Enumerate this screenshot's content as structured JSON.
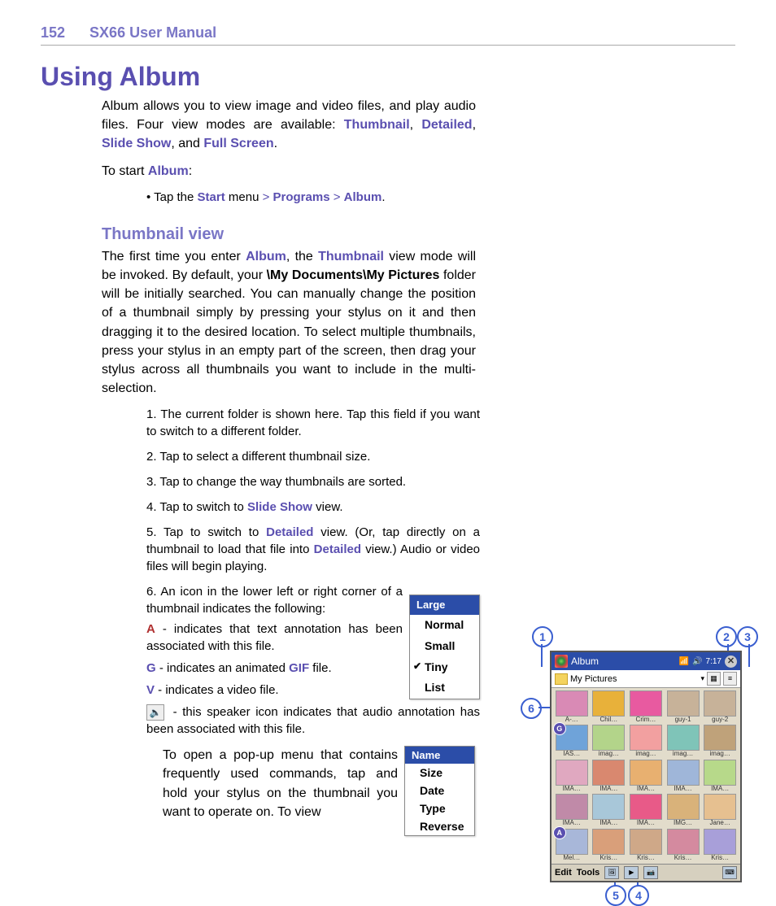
{
  "header": {
    "page_number": "152",
    "manual_title": "SX66 User Manual"
  },
  "main_heading": "Using Album",
  "intro": {
    "pre": "Album allows you to view image and video files, and play audio files. Four view modes are available: ",
    "m1": "Thumbnail",
    "c1": ", ",
    "m2": "Detailed",
    "c2": ", ",
    "m3": "Slide Show",
    "c3": ", and ",
    "m4": "Full Screen",
    "post": "."
  },
  "to_start": {
    "pre": "To start ",
    "link": "Album",
    "post": ":"
  },
  "bullet": {
    "pre": "• Tap the ",
    "l1": "Start",
    "mid1": " menu ",
    "s1": "> ",
    "l2": "Programs",
    "s2": " > ",
    "l3": "Album",
    "post": "."
  },
  "sub_heading": "Thumbnail view",
  "para2": {
    "t1": "The first time you enter ",
    "l1": "Album",
    "t2": ", the ",
    "l2": "Thumbnail",
    "t3": " view mode will be invoked. By default, your ",
    "b1": "\\My Documents\\My Pictures",
    "t4": " folder will be initially searched. You can manually change the position of a thumbnail simply by pressing your stylus on it and then dragging it to the desired location. To select multiple thumbnails, press your stylus in an empty part of the screen, then drag your stylus across all thumbnails you want to include in the multi-selection."
  },
  "list": {
    "i1": "1. The current folder is shown here. Tap this field if you want to switch to a different folder.",
    "i2": "2. Tap to select a different thumbnail size.",
    "i3": "3. Tap to change the way thumbnails are sorted.",
    "i4": {
      "pre": "4. Tap to switch to ",
      "link": "Slide Show",
      "post": " view."
    },
    "i5": {
      "pre": "5. Tap to switch to ",
      "l1": "Detailed",
      "mid": " view. (Or, tap directly on a thumbnail to load that file into ",
      "l2": "Detailed",
      "post": " view.) Audio or video files will begin playing."
    },
    "i6": "6. An icon in the lower left or right corner of a thumbnail indicates the following:",
    "i6a": " - indicates that text annotation has been associated with this file.",
    "i6g_pre": " - indicates an animated ",
    "i6g_link": "GIF",
    "i6g_post": " file.",
    "i6v": " - indicates a video file.",
    "i6s": " - this speaker icon indicates that audio annotation has been associated with this file."
  },
  "letters": {
    "a": "A",
    "g": "G",
    "v": "V"
  },
  "size_menu": {
    "header": "Large",
    "items": [
      "Normal",
      "Small",
      "Tiny",
      "List"
    ],
    "checked": "Tiny"
  },
  "sort_menu": {
    "header": "Name",
    "items": [
      "Size",
      "Date",
      "Type",
      "Reverse"
    ]
  },
  "bottom_para": "To open a pop-up menu that contains frequently used commands, tap and hold your stylus on the thumbnail you want to operate on. To view",
  "callouts": {
    "c1": "1",
    "c2": "2",
    "c3": "3",
    "c4": "4",
    "c5": "5",
    "c6": "6"
  },
  "device": {
    "title": "Album",
    "signal_time": "7:17",
    "path": "My Pictures",
    "edit": "Edit",
    "tools": "Tools",
    "thumbs": [
      {
        "n": "A-…",
        "c": "#d98ab5"
      },
      {
        "n": "Chil…",
        "c": "#e8b13a"
      },
      {
        "n": "Crim…",
        "c": "#e85aa0"
      },
      {
        "n": "guy-1",
        "c": "#c7b299"
      },
      {
        "n": "guy-2",
        "c": "#c7b299"
      },
      {
        "n": "IAS…",
        "c": "#6fa3d9",
        "b": "G"
      },
      {
        "n": "imag…",
        "c": "#b3d48a"
      },
      {
        "n": "imag…",
        "c": "#f2a0a0"
      },
      {
        "n": "imag…",
        "c": "#7fc4b8"
      },
      {
        "n": "imag…",
        "c": "#bfa27a"
      },
      {
        "n": "IMA…",
        "c": "#e0a8c0"
      },
      {
        "n": "IMA…",
        "c": "#d9886f"
      },
      {
        "n": "IMA…",
        "c": "#e8b070"
      },
      {
        "n": "IMA…",
        "c": "#9fb6d9"
      },
      {
        "n": "IMA…",
        "c": "#b7d98a"
      },
      {
        "n": "IMA…",
        "c": "#c08aa8"
      },
      {
        "n": "IMA…",
        "c": "#a8c7d9"
      },
      {
        "n": "IMA…",
        "c": "#e85a88"
      },
      {
        "n": "IMG…",
        "c": "#d9b27a"
      },
      {
        "n": "Jane…",
        "c": "#e6c090"
      },
      {
        "n": "Mel…",
        "c": "#a8b7d9",
        "b": "A"
      },
      {
        "n": "Kris…",
        "c": "#d99f7a"
      },
      {
        "n": "Kris…",
        "c": "#cfa888"
      },
      {
        "n": "Kris…",
        "c": "#d48a9f"
      },
      {
        "n": "Kris…",
        "c": "#a89fd9"
      }
    ]
  }
}
